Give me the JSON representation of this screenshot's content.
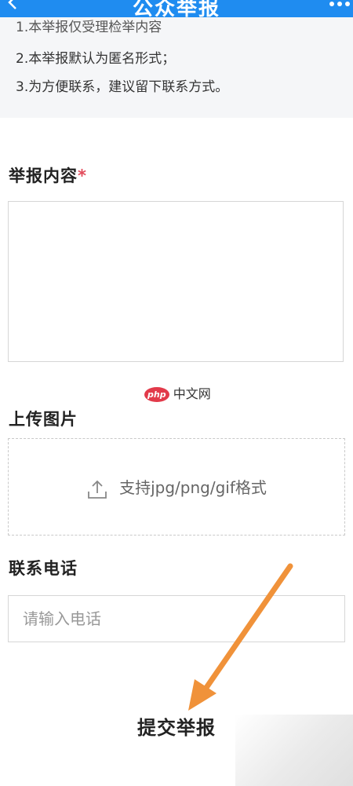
{
  "header": {
    "title": "公众举报",
    "back_icon": "chevron-left-icon",
    "more_icon": "more-dots-icon"
  },
  "notice": {
    "partial_line": "1.本举报仅受理检举内容",
    "line2": "2.本举报默认为匿名形式；",
    "line3": "3.为方便联系，建议留下联系方式。"
  },
  "content_section": {
    "label": "举报内容",
    "required_mark": "*"
  },
  "watermark": {
    "badge": "php",
    "text": "中文网"
  },
  "upload_section": {
    "label": "上传图片",
    "hint": "支持jpg/png/gif格式",
    "icon": "upload-icon"
  },
  "phone_section": {
    "label": "联系电话",
    "placeholder": "请输入电话"
  },
  "submit": {
    "label": "提交举报"
  },
  "colors": {
    "header_bg": "#1f8cf0",
    "required": "#e24b5b",
    "arrow": "#f0923a"
  }
}
